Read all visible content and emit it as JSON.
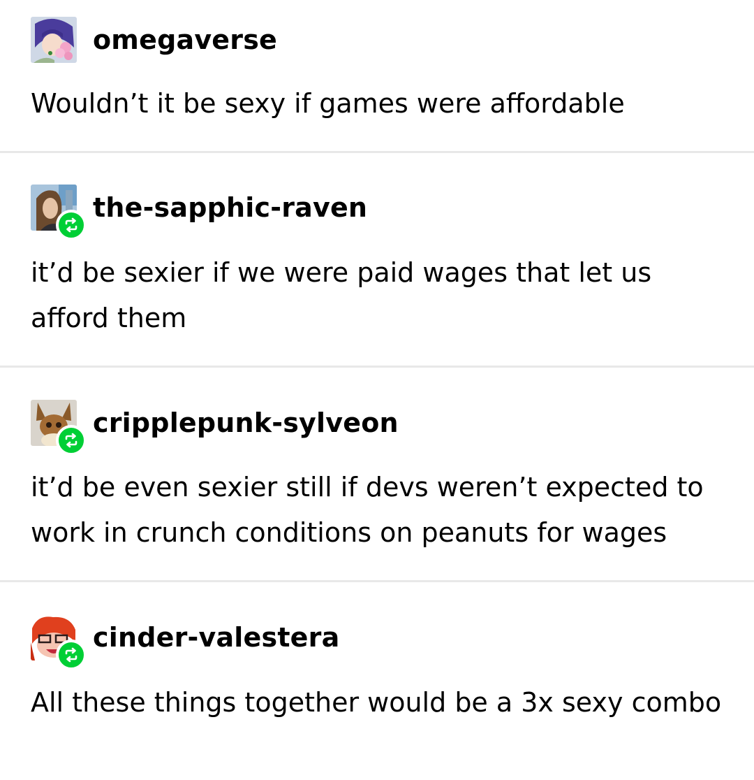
{
  "posts": [
    {
      "username": "omegaverse",
      "text": "Wouldn’t it be sexy if games were affordable",
      "reblog": false,
      "avatar_icon": "anime-girl-avatar"
    },
    {
      "username": "the-sapphic-raven",
      "text": "it’d be sexier if we were paid wages that let us afford them",
      "reblog": true,
      "avatar_icon": "selfie-avatar"
    },
    {
      "username": "cripplepunk-sylveon",
      "text": "it’d be even sexier still if devs weren’t expected to work in crunch conditions on peanuts for wages",
      "reblog": true,
      "avatar_icon": "eevee-plush-avatar"
    },
    {
      "username": "cinder-valestera",
      "text": "All these things together would be a 3x sexy combo",
      "reblog": true,
      "avatar_icon": "red-hair-cartoon-avatar"
    }
  ],
  "colors": {
    "reblog_badge": "#00cf35",
    "divider": "#e8e8e8",
    "text": "#000000"
  }
}
